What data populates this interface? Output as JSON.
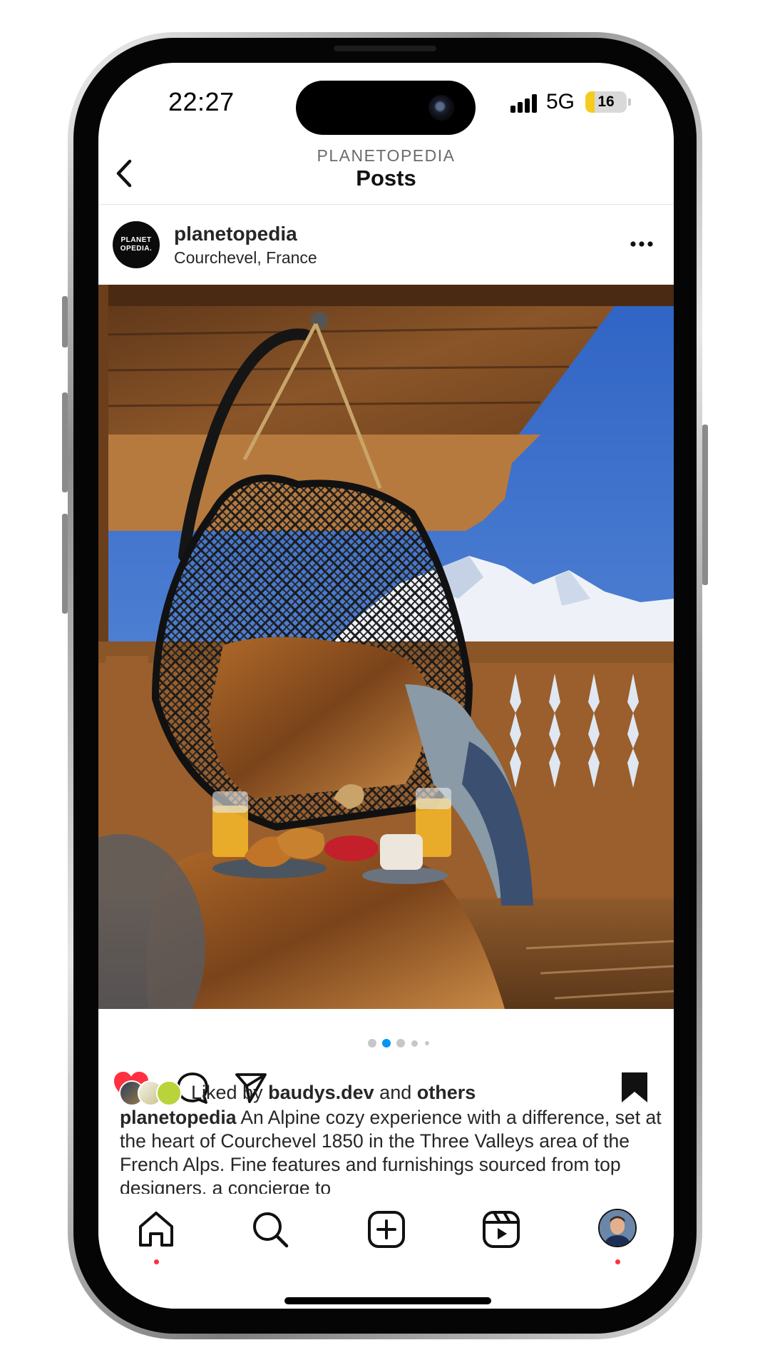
{
  "status_bar": {
    "time": "22:27",
    "network": "5G",
    "battery": "16"
  },
  "header": {
    "subtitle": "PLANETOPEDIA",
    "title": "Posts",
    "back_icon": "chevron-left-icon"
  },
  "post": {
    "avatar_text": "PLANET OPEDIA.",
    "username": "planetopedia",
    "location": "Courchevel, France",
    "more_icon": "ellipsis-icon",
    "image": "hanging-wicker-chair-breakfast-alpine-balcony",
    "carousel": {
      "count": 5,
      "active": 2
    },
    "actions": {
      "like_icon": "heart-filled-icon",
      "comment_icon": "comment-icon",
      "share_icon": "send-icon",
      "save_icon": "bookmark-filled-icon"
    },
    "likes": {
      "prefix": "Liked by",
      "user": "baudys.dev",
      "joiner": "and",
      "others": "others"
    },
    "caption": {
      "user": "planetopedia",
      "text": "An Alpine cozy experience with a difference, set at the heart of Courchevel 1850 in the Three Valleys area of the French Alps. Fine features and furnishings sourced from top designers, a concierge to"
    }
  },
  "bottom_nav": [
    {
      "name": "home",
      "icon": "home-icon",
      "notification": true
    },
    {
      "name": "search",
      "icon": "search-icon",
      "notification": false
    },
    {
      "name": "create",
      "icon": "plus-square-icon",
      "notification": false
    },
    {
      "name": "reels",
      "icon": "reels-icon",
      "notification": false
    },
    {
      "name": "profile",
      "icon": "profile-avatar",
      "notification": true
    }
  ],
  "colors": {
    "like_red": "#ff3040",
    "carousel_active": "#0095f6",
    "text": "#262626"
  }
}
